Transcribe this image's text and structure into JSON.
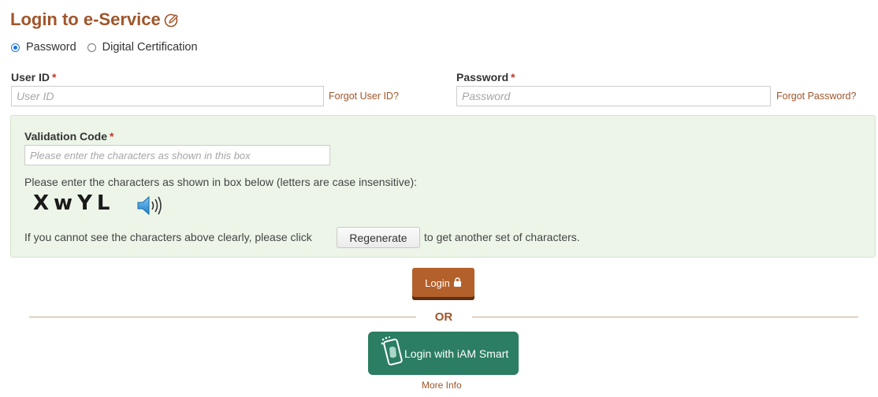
{
  "page": {
    "title": "Login to e-Service",
    "title_icon": "edit-help-icon",
    "accent_color": "#a0552a"
  },
  "auth_method": {
    "options": [
      {
        "label": "Password",
        "selected": true
      },
      {
        "label": "Digital Certification",
        "selected": false
      }
    ]
  },
  "user_id": {
    "label": "User ID",
    "required_mark": "*",
    "value": "",
    "placeholder": "User ID",
    "forgot_link": "Forgot User ID?"
  },
  "password": {
    "label": "Password",
    "required_mark": "*",
    "value": "",
    "placeholder": "Password",
    "forgot_link": "Forgot Password?"
  },
  "validation": {
    "label": "Validation Code",
    "required_mark": "*",
    "value": "",
    "placeholder": "Please enter the characters as shown in this box",
    "instruction": "Please enter the characters as shown in box below (letters are case insensitive):",
    "captcha_text": "XwYL",
    "speaker_icon": "speaker-icon",
    "regen_prefix": "If you cannot see the characters above clearly, please click",
    "regen_button": "Regenerate",
    "regen_suffix": "to get another set of characters.",
    "panel_color": "#ecf5e8"
  },
  "actions": {
    "login_label": "Login",
    "login_icon": "lock-icon",
    "login_color": "#b4602b",
    "or_label": "OR",
    "iam_label": "Login with iAM Smart",
    "iam_icon": "iam-smart-phone-icon",
    "iam_color": "#2b7d63",
    "more_info": "More Info"
  }
}
